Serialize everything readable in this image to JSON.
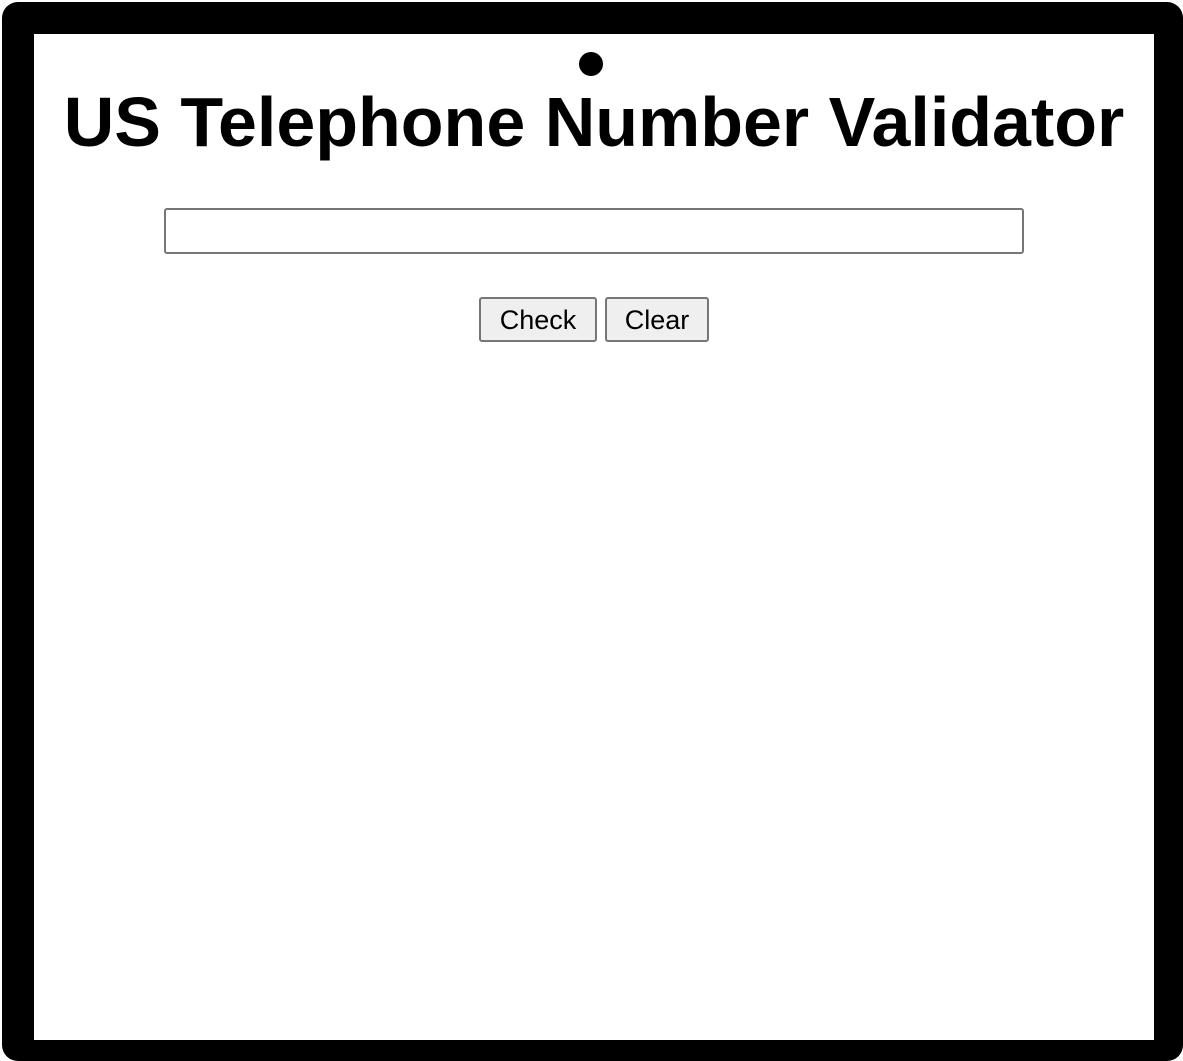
{
  "page": {
    "title": "US Telephone Number Validator"
  },
  "form": {
    "input_value": "",
    "input_placeholder": "",
    "check_label": "Check",
    "clear_label": "Clear"
  },
  "colors": {
    "frame": "#000000",
    "screen": "#ffffff",
    "button_bg": "#efefef",
    "border": "#767676"
  }
}
